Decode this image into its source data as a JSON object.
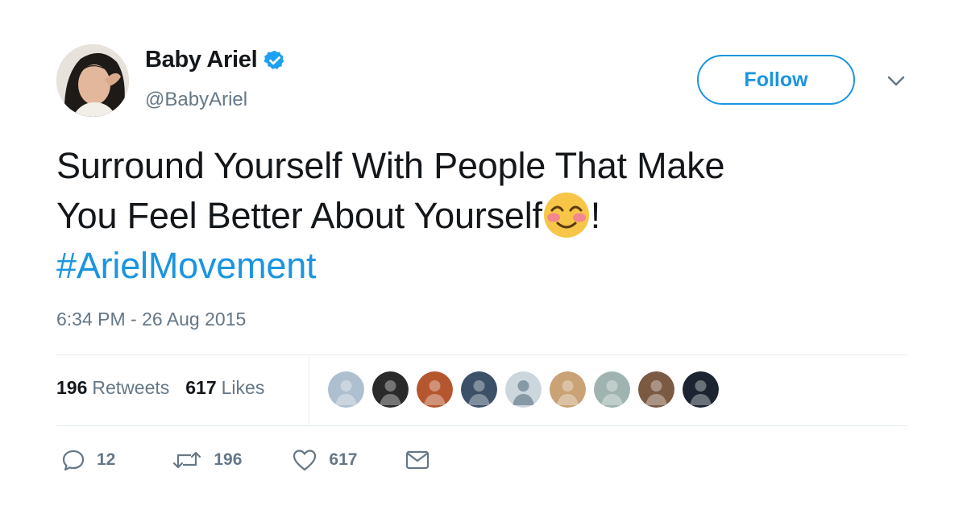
{
  "author": {
    "name": "Baby Ariel",
    "handle": "@BabyAriel",
    "verified": true
  },
  "follow_button": {
    "label": "Follow"
  },
  "tweet": {
    "line1": "Surround Yourself With People That Make",
    "line2": "You Feel Better About Yourself",
    "line2_end": "!",
    "hashtag": "#ArielMovement",
    "emoji": "smiling-face-with-blush-emoji"
  },
  "timestamp": "6:34 PM - 26 Aug 2015",
  "stats": {
    "retweets_count": "196",
    "retweets_label": "Retweets",
    "likes_count": "617",
    "likes_label": "Likes"
  },
  "likers": [
    {
      "icon": "liker-avatar",
      "color": "#aebfd0"
    },
    {
      "icon": "liker-avatar",
      "color": "#2a2a2a"
    },
    {
      "icon": "liker-avatar",
      "color": "#b5562e"
    },
    {
      "icon": "liker-avatar",
      "color": "#3c5068"
    },
    {
      "icon": "default-avatar",
      "color": "#ccd6dd"
    },
    {
      "icon": "liker-avatar",
      "color": "#c9a276"
    },
    {
      "icon": "liker-avatar",
      "color": "#9fb4b0"
    },
    {
      "icon": "liker-avatar",
      "color": "#7b5a44"
    },
    {
      "icon": "liker-avatar",
      "color": "#1b2430"
    }
  ],
  "actions": {
    "reply_count": "12",
    "retweet_count": "196",
    "like_count": "617"
  },
  "colors": {
    "accent": "#1b95e0",
    "secondary_text": "#657786",
    "primary_text": "#14171a"
  }
}
